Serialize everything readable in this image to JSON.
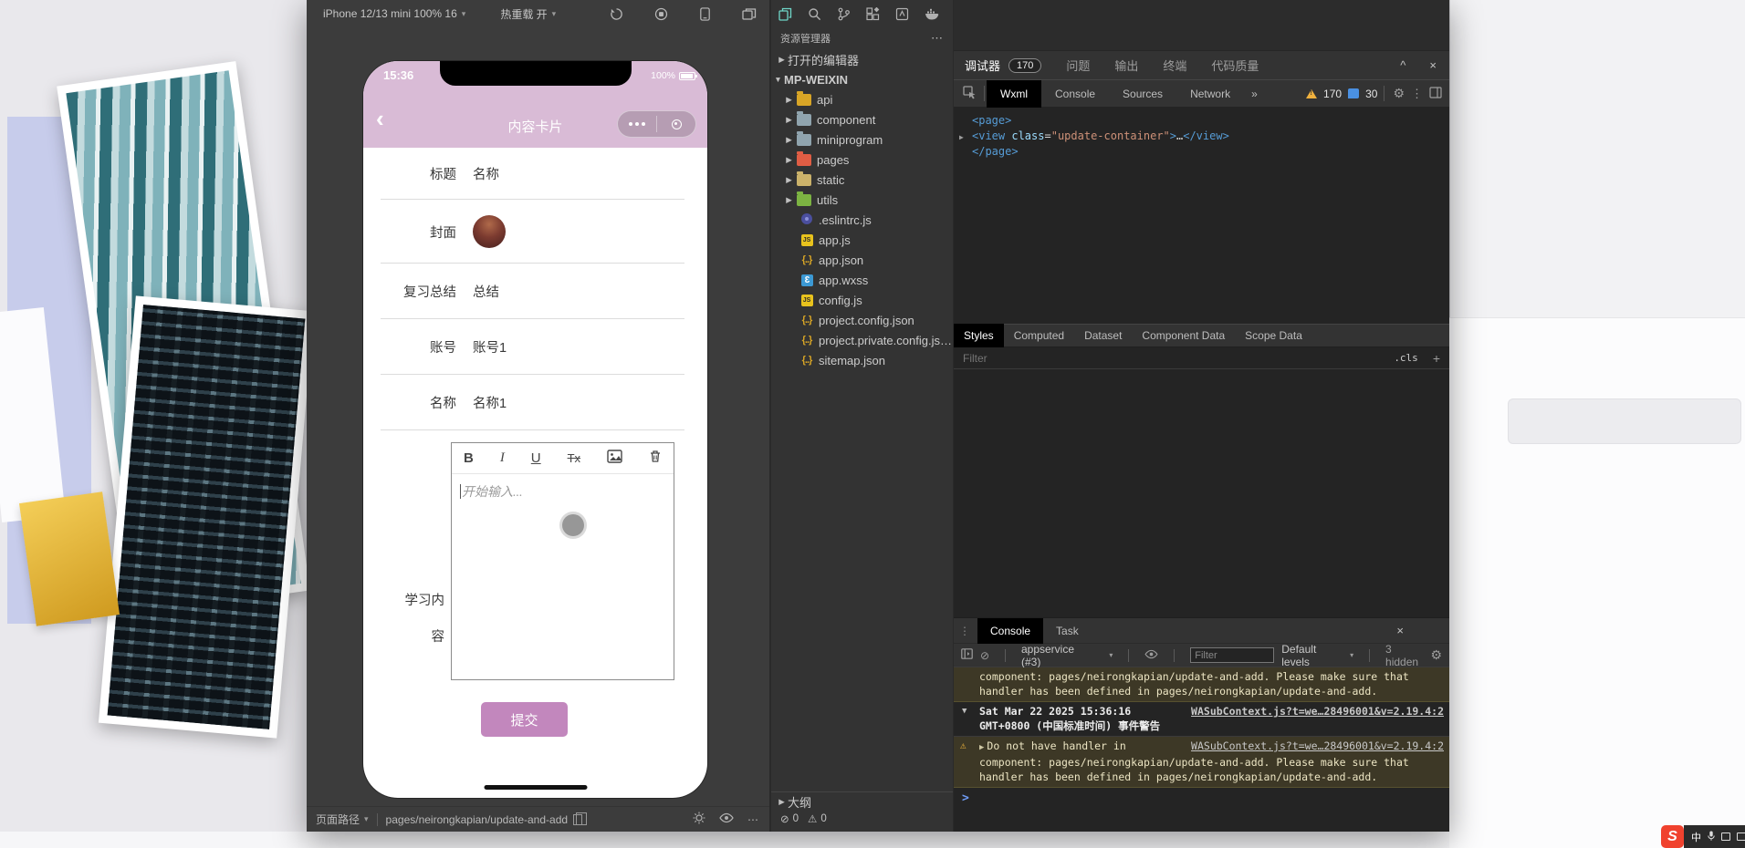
{
  "icons": {
    "caret_down": "▾",
    "chev_right": "▶",
    "chev_down": "▼",
    "close": "×",
    "collapse": "^",
    "more_h": "⋯",
    "more_v": "⋮",
    "overflow": "»",
    "back": "‹",
    "prompt": ">",
    "blocked": "⊘",
    "warn": "⚠",
    "gear": "⚙",
    "json": "{..}",
    "wxss": "3"
  },
  "device_toolbar": {
    "device": "iPhone 12/13 mini 100% 16",
    "hot_reload": "热重载 开"
  },
  "phone": {
    "time": "15:36",
    "battery": "100%",
    "nav_title": "内容卡片",
    "rows": [
      {
        "label": "标题",
        "value": "名称"
      },
      {
        "label": "封面",
        "value": ""
      },
      {
        "label": "复习总结",
        "value": "总结"
      },
      {
        "label": "账号",
        "value": "账号1"
      },
      {
        "label": "名称",
        "value": "名称1"
      }
    ],
    "content_label": "学习内容",
    "editor_icons": {
      "bold": "B",
      "italic": "I",
      "underline": "U",
      "clear": "Tx"
    },
    "editor_placeholder": "开始输入...",
    "submit": "提交"
  },
  "sim_bottom": {
    "path_label": "页面路径",
    "path": "pages/neirongkapian/update-and-add"
  },
  "explorer": {
    "title": "资源管理器",
    "open_editors": "打开的编辑器",
    "root": "MP-WEIXIN",
    "folders": [
      {
        "name": "api",
        "icon": "folder-api"
      },
      {
        "name": "component",
        "icon": "folder-plain"
      },
      {
        "name": "miniprogram",
        "icon": "folder-plain"
      },
      {
        "name": "pages",
        "icon": "folder-pages"
      },
      {
        "name": "static",
        "icon": "folder-static"
      },
      {
        "name": "utils",
        "icon": "folder-utils"
      }
    ],
    "files": [
      {
        "name": ".eslintrc.js",
        "icon": "eslint"
      },
      {
        "name": "app.js",
        "icon": "js"
      },
      {
        "name": "app.json",
        "icon": "json"
      },
      {
        "name": "app.wxss",
        "icon": "wxss"
      },
      {
        "name": "config.js",
        "icon": "js"
      },
      {
        "name": "project.config.json",
        "icon": "json"
      },
      {
        "name": "project.private.config.js…",
        "icon": "json"
      },
      {
        "name": "sitemap.json",
        "icon": "json"
      }
    ],
    "outline": "大纲",
    "error_count": "0",
    "warning_count": "0"
  },
  "debugger": {
    "tabs": {
      "debugger": "调试器",
      "badge": "170",
      "problems": "问题",
      "output": "输出",
      "terminal": "终端",
      "quality": "代码质量"
    },
    "cdt": {
      "wxml": "Wxml",
      "console": "Console",
      "sources": "Sources",
      "network": "Network"
    },
    "counts": {
      "warnings": "170",
      "issues": "30"
    },
    "wxml": {
      "open": "<page>",
      "tag_open": "<view",
      "attr_name": "class",
      "eq": "=",
      "attr_value": "\"update-container\"",
      "gt": ">",
      "dots": "…",
      "tag_close": "</view>",
      "close": "</page>"
    },
    "styles": {
      "tabs": [
        "Styles",
        "Computed",
        "Dataset",
        "Component Data",
        "Scope Data"
      ],
      "filter_placeholder": "Filter",
      "cls": ".cls",
      "plus": "+"
    },
    "console": {
      "tab_console": "Console",
      "tab_task": "Task",
      "context": "appservice (#3)",
      "filter_placeholder": "Filter",
      "levels": "Default levels",
      "hidden": "3 hidden",
      "msg1_line1": "component: pages/neirongkapian/update-and-add. Please make sure that",
      "msg1_line2": "handler has been defined in pages/neirongkapian/update-and-add.",
      "group_time": "Sat Mar 22 2025 15:36:16",
      "group_time2": "GMT+0800 (中国标准时间) 事件警告",
      "group_src": "WASubContext.js?t=we…28496001&v=2.19.4:2",
      "warn_line1": "Do not have  handler in",
      "warn_src": "WASubContext.js?t=we…28496001&v=2.19.4:2",
      "warn_line2": "component: pages/neirongkapian/update-and-add. Please make sure that",
      "warn_line3": "handler has been defined in pages/neirongkapian/update-and-add."
    }
  },
  "ime": {
    "lang": "中"
  }
}
